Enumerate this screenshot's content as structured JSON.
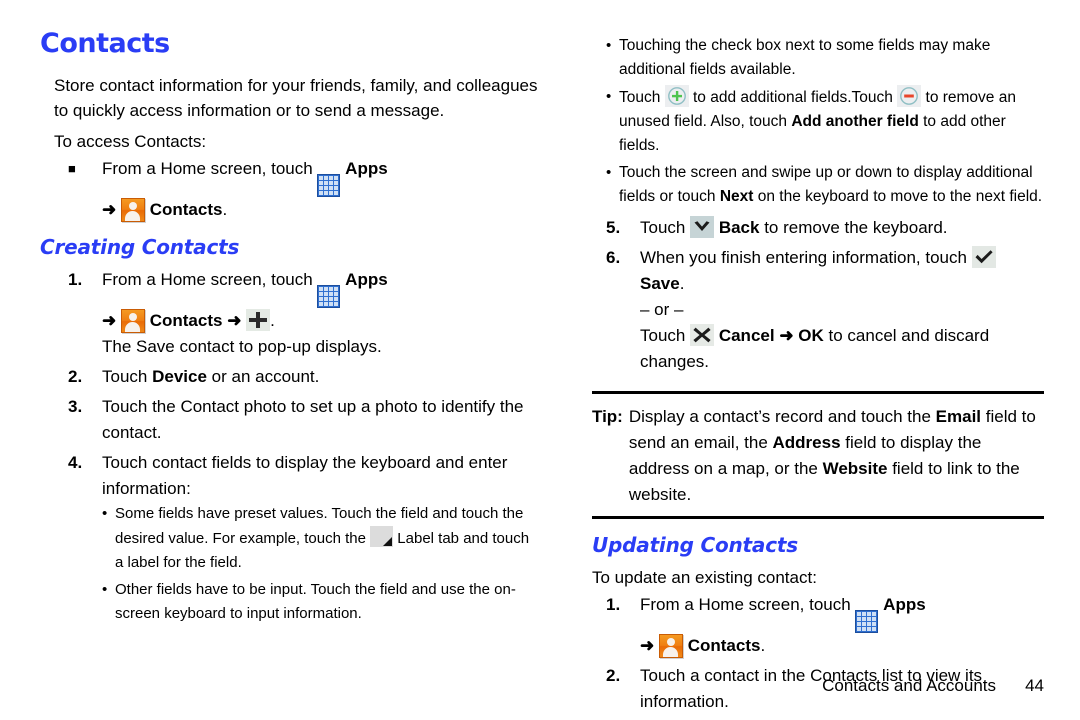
{
  "page": {
    "title": "Contacts",
    "footer_chapter": "Contacts and Accounts",
    "footer_page": "44"
  },
  "colors": {
    "heading_blue": "#2a3df5",
    "apps_icon_blue": "#2f6fd0",
    "contacts_icon_orange": "#ef7f12",
    "plus_circle_green": "#4ec44e",
    "minus_circle_teal": "#7fb6bb",
    "minus_bar_red": "#e8452a",
    "rule_black": "#000000"
  },
  "icons": {
    "apps": "apps-grid-icon",
    "contacts": "contacts-person-icon",
    "plus": "plus-icon",
    "label_tab": "label-dropdown-tab-icon",
    "plus_circle": "add-field-plus-circle-icon",
    "minus_circle": "remove-field-minus-circle-icon",
    "back": "back-chevron-down-icon",
    "save": "save-checkmark-icon",
    "cancel": "cancel-x-icon"
  },
  "left": {
    "intro": "Store contact information for your friends, family, and colleagues to quickly access information or to send a message.",
    "access_lead": "To access Contacts:",
    "access_step": {
      "marker": "■",
      "text_before": "From a Home screen, touch",
      "apps_label": "Apps",
      "arrow": "➜",
      "contacts_label": "Contacts",
      "period": "."
    },
    "creating_title": "Creating Contacts",
    "steps": [
      {
        "marker": "1.",
        "text_before": "From a Home screen, touch",
        "apps_label": "Apps",
        "arrow1": "➜",
        "contacts_label": "Contacts",
        "arrow2": "➜",
        "period": ".",
        "continuation": "The Save contact to pop-up displays."
      },
      {
        "marker": "2.",
        "pre": "Touch ",
        "bold": "Device",
        "post": " or an account."
      },
      {
        "marker": "3.",
        "text": "Touch the Contact photo to set up a photo to identify the contact."
      },
      {
        "marker": "4.",
        "text": "Touch contact fields to display the keyboard and enter information:",
        "subbullets": [
          {
            "dot": "•",
            "pre": "Some fields have preset values. Touch the field and touch the desired value. For example, touch the ",
            "post": " Label tab and touch a label for the field."
          },
          {
            "dot": "•",
            "text": "Other fields have to be input. Touch the field and use the on-screen keyboard to input information."
          }
        ]
      }
    ]
  },
  "right": {
    "subbullets_top": [
      {
        "dot": "•",
        "text": "Touching the check box next to some fields may make additional fields available."
      },
      {
        "dot": "•",
        "seg1": "Touch ",
        "seg2": " to add additional fields.Touch ",
        "seg3": " to remove an unused field. Also, touch ",
        "bold": "Add another field",
        "seg4": " to add other fields."
      },
      {
        "dot": "•",
        "pre": "Touch the screen and swipe up or down to display additional fields or touch ",
        "bold": "Next",
        "post": " on the keyboard to move to the next field."
      }
    ],
    "steps": [
      {
        "marker": "5.",
        "pre": "Touch ",
        "bold": "Back",
        "post": " to remove the keyboard."
      },
      {
        "marker": "6.",
        "pre": "When you finish entering information, touch ",
        "bold": "Save",
        "post": ".",
        "or_text": "– or –",
        "alt_pre": "Touch ",
        "alt_bold1": "Cancel",
        "alt_arrow": "➜",
        "alt_bold2": "OK",
        "alt_post": " to cancel and discard changes."
      }
    ],
    "tip": {
      "label": "Tip:",
      "seg1": "Display a contact’s record and touch the ",
      "bold1": "Email",
      "seg2": " field to send an email, the ",
      "bold2": "Address",
      "seg3": " field to display the address on a map, or the ",
      "bold3": "Website",
      "seg4": " field to link to the website."
    },
    "updating_title": "Updating Contacts",
    "updating_lead": "To update an existing contact:",
    "updating_steps": [
      {
        "marker": "1.",
        "text_before": "From a Home screen, touch",
        "apps_label": "Apps",
        "arrow": "➜",
        "contacts_label": "Contacts",
        "period": "."
      },
      {
        "marker": "2.",
        "text": "Touch a contact in the Contacts list to view its information."
      }
    ]
  }
}
